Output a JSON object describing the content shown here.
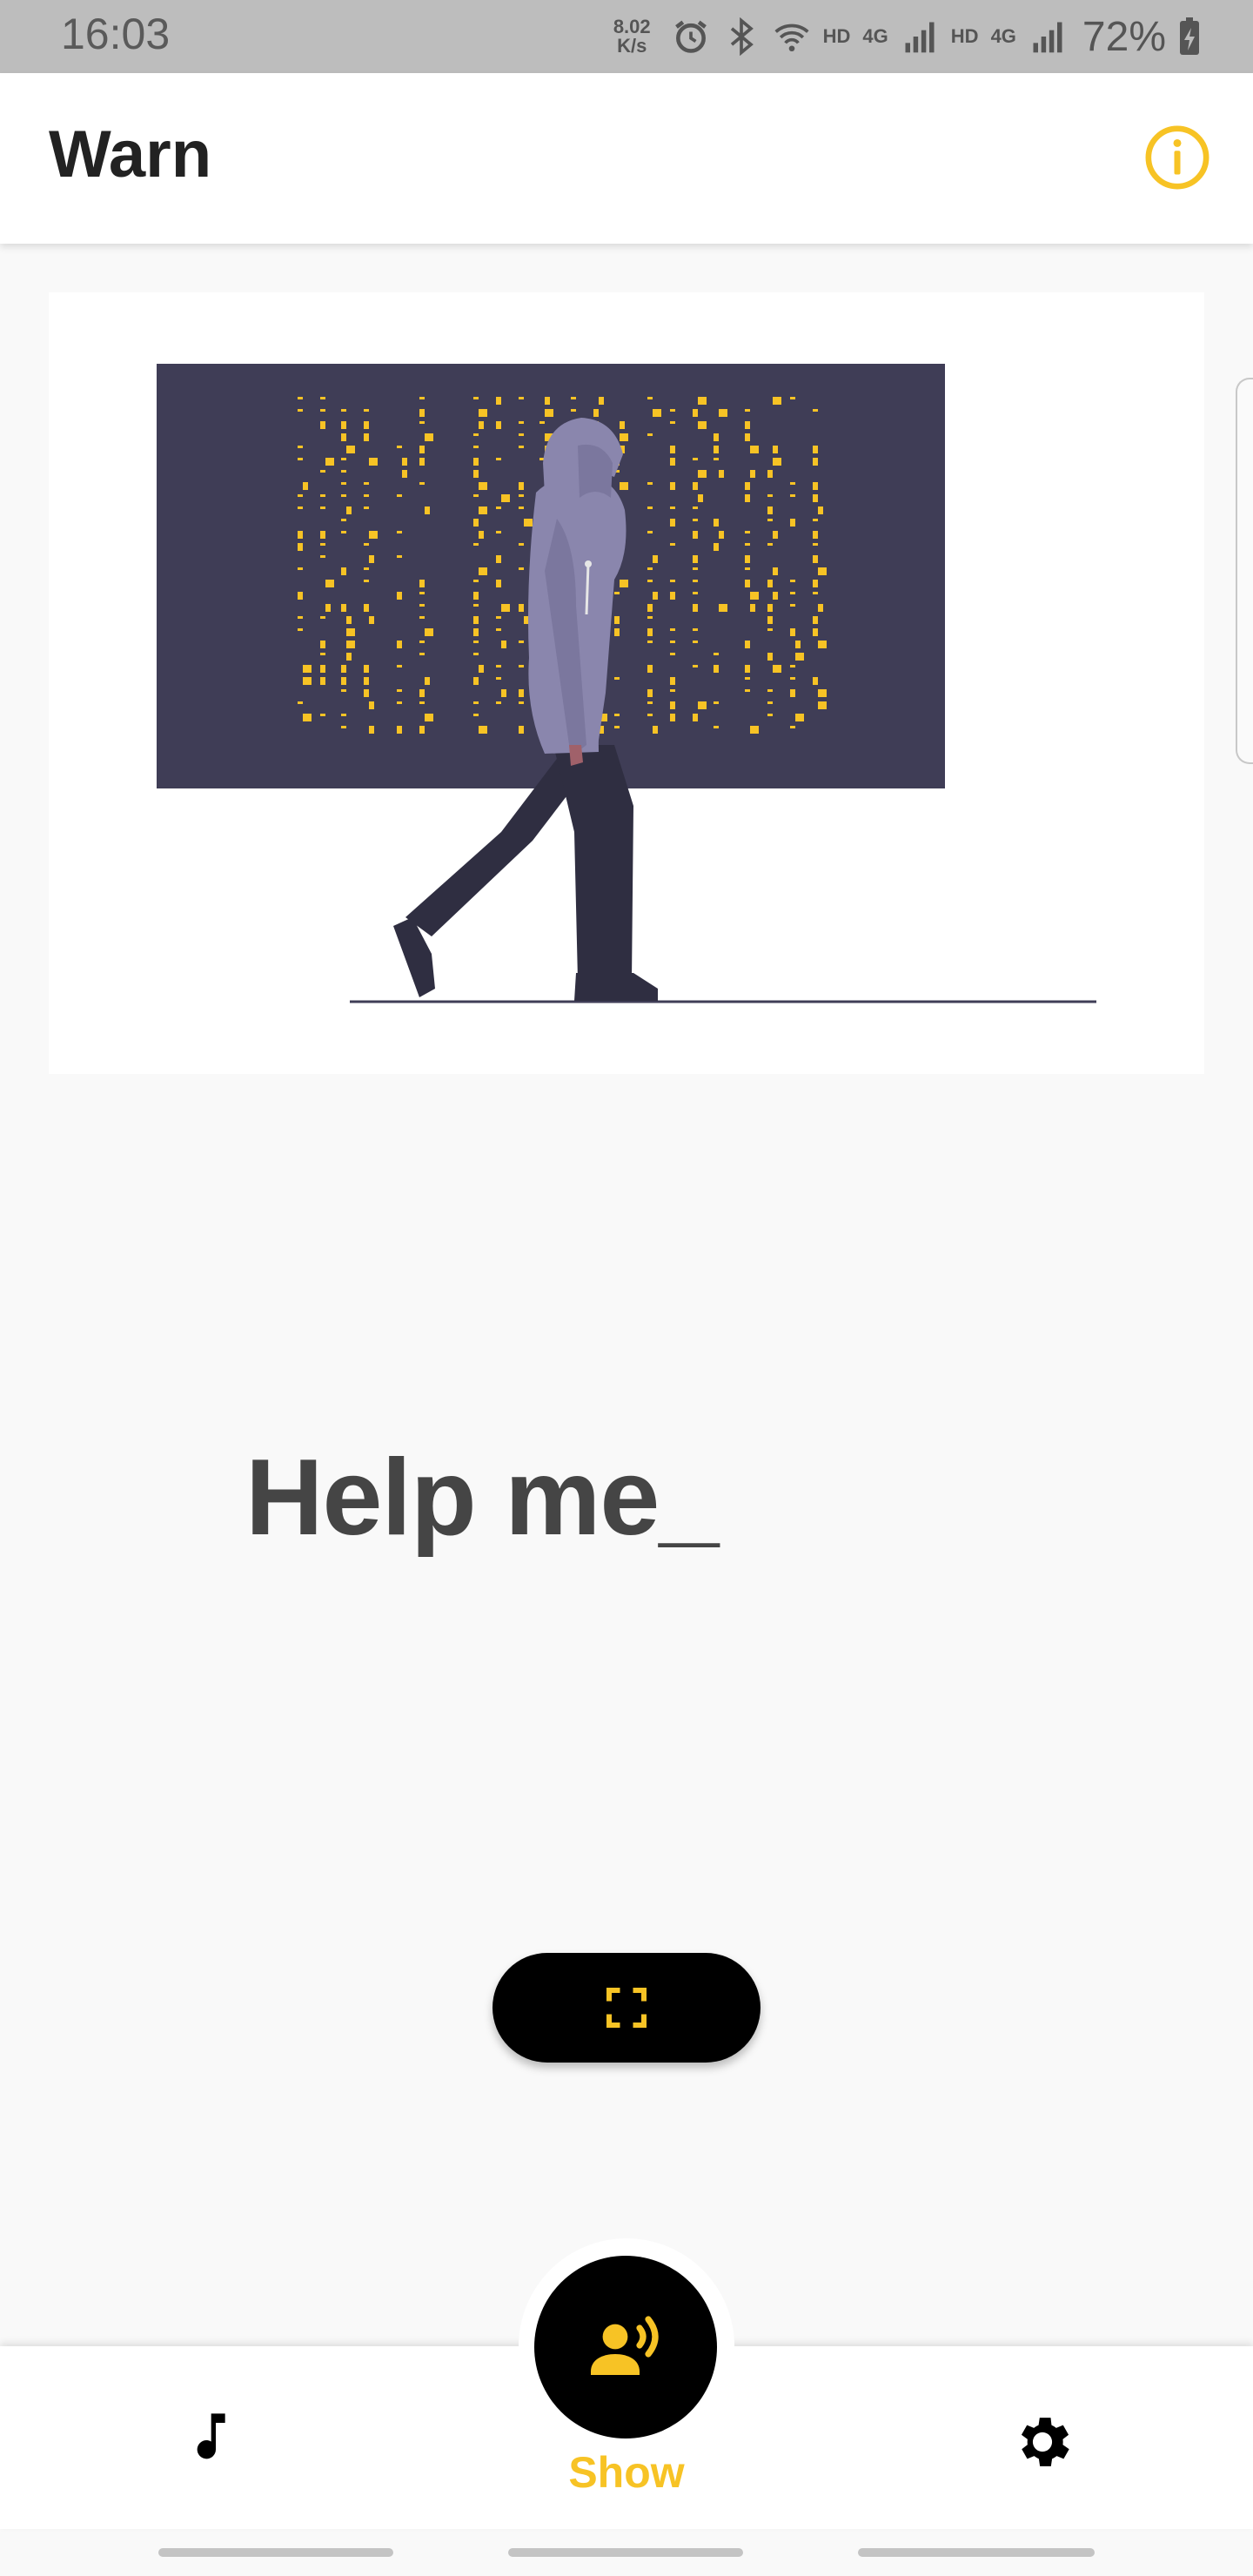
{
  "status_bar": {
    "time": "16:03",
    "net_speed_value": "8.02",
    "net_speed_unit": "K/s",
    "hd1": "HD",
    "net1": "4G",
    "hd2": "HD",
    "net2": "4G",
    "battery": "72%"
  },
  "app_bar": {
    "title": "Warn",
    "info_icon": "info-icon"
  },
  "main": {
    "message": "Help me_",
    "fullscreen_icon": "fullscreen-icon"
  },
  "bottom_nav": {
    "items": [
      {
        "icon": "music-note-icon"
      },
      {
        "icon": "speaker-person-icon",
        "label": "Show",
        "selected": true
      },
      {
        "icon": "gear-icon"
      }
    ]
  },
  "colors": {
    "accent": "#f7c325",
    "dark": "#000000",
    "screen": "#3f3d56",
    "hoodie": "#8a86ad"
  }
}
